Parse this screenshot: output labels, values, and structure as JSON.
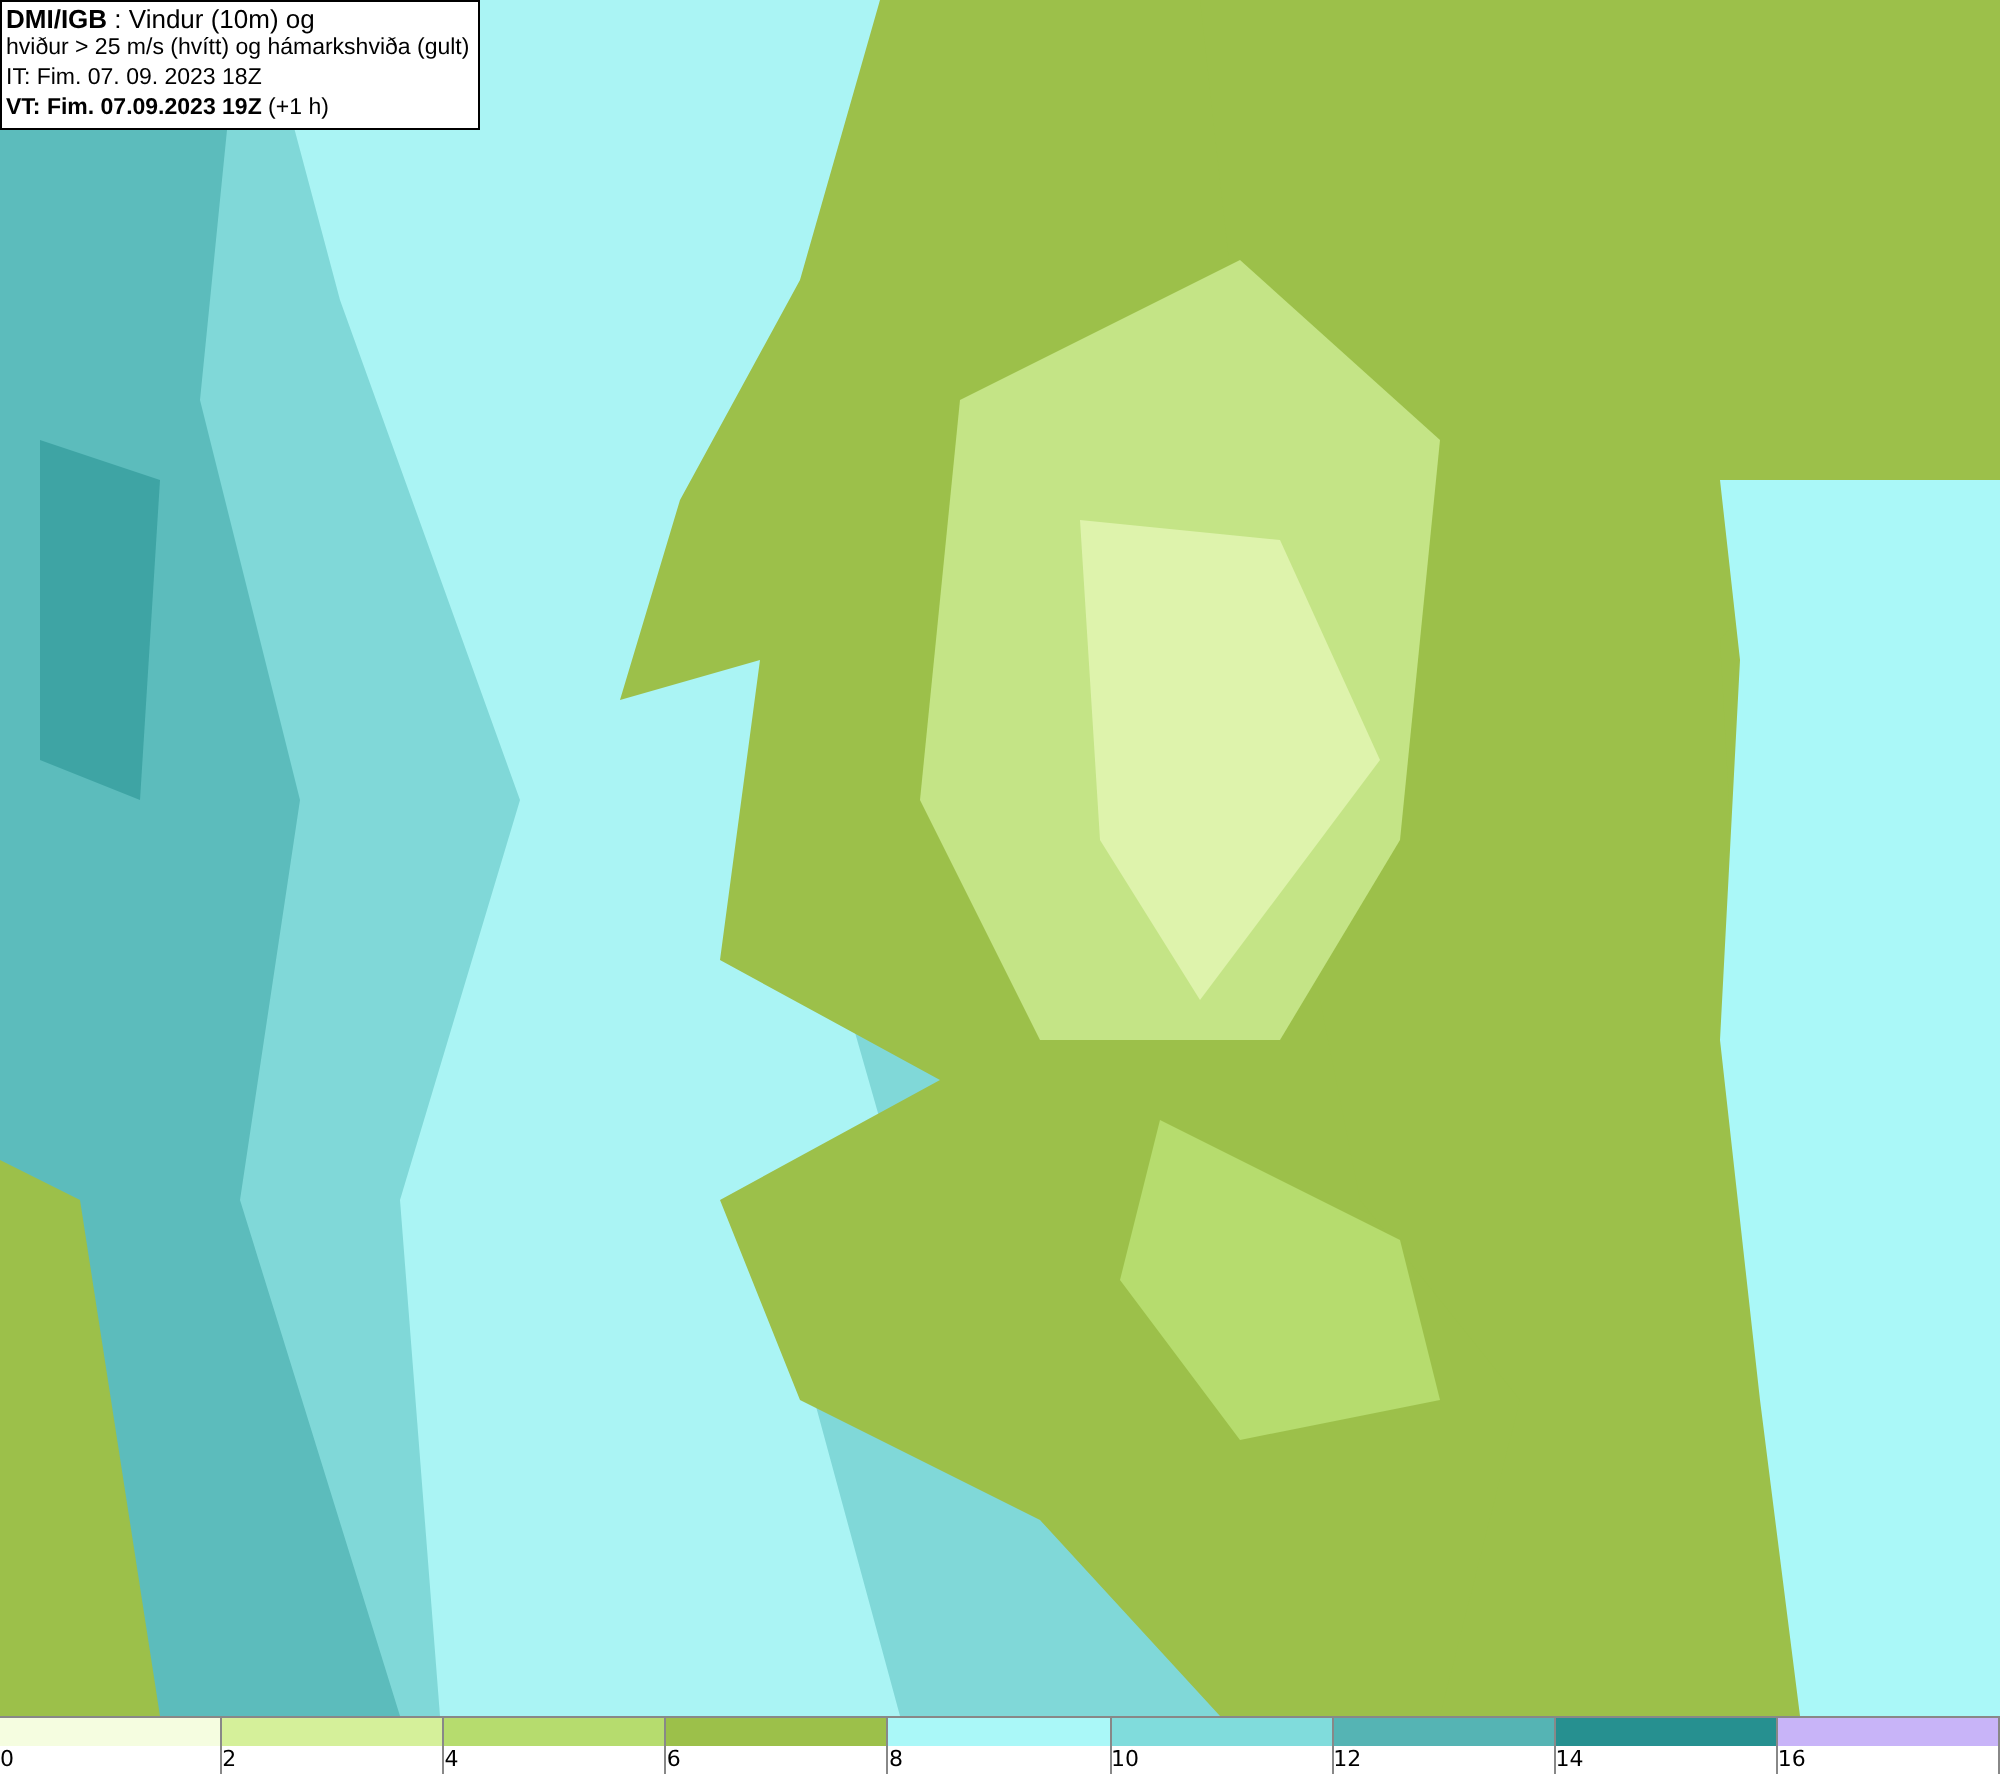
{
  "info_box": {
    "lines": [
      "**DMI/IGB** : Vindur (10m) og",
      "hviður > 25 m/s (hvítt) og hámarkshviða (gult)",
      "IT: Fim. 07. 09. 2023 18Z",
      "**VT: Fim. 07.09.2023 19Z** (+1 h)"
    ]
  },
  "legend": [
    {
      "label": "0",
      "color": "#f5fde0"
    },
    {
      "label": "2",
      "color": "#d5f09a"
    },
    {
      "label": "4",
      "color": "#b6dc6e"
    },
    {
      "label": "6",
      "color": "#9cc04a"
    },
    {
      "label": "8",
      "color": "#aaf8f8"
    },
    {
      "label": "10",
      "color": "#80dcdc"
    },
    {
      "label": "12",
      "color": "#55b4b4"
    },
    {
      "label": "14",
      "color": "#269090"
    },
    {
      "label": "16",
      "color": "#c8b4f8"
    }
  ]
}
